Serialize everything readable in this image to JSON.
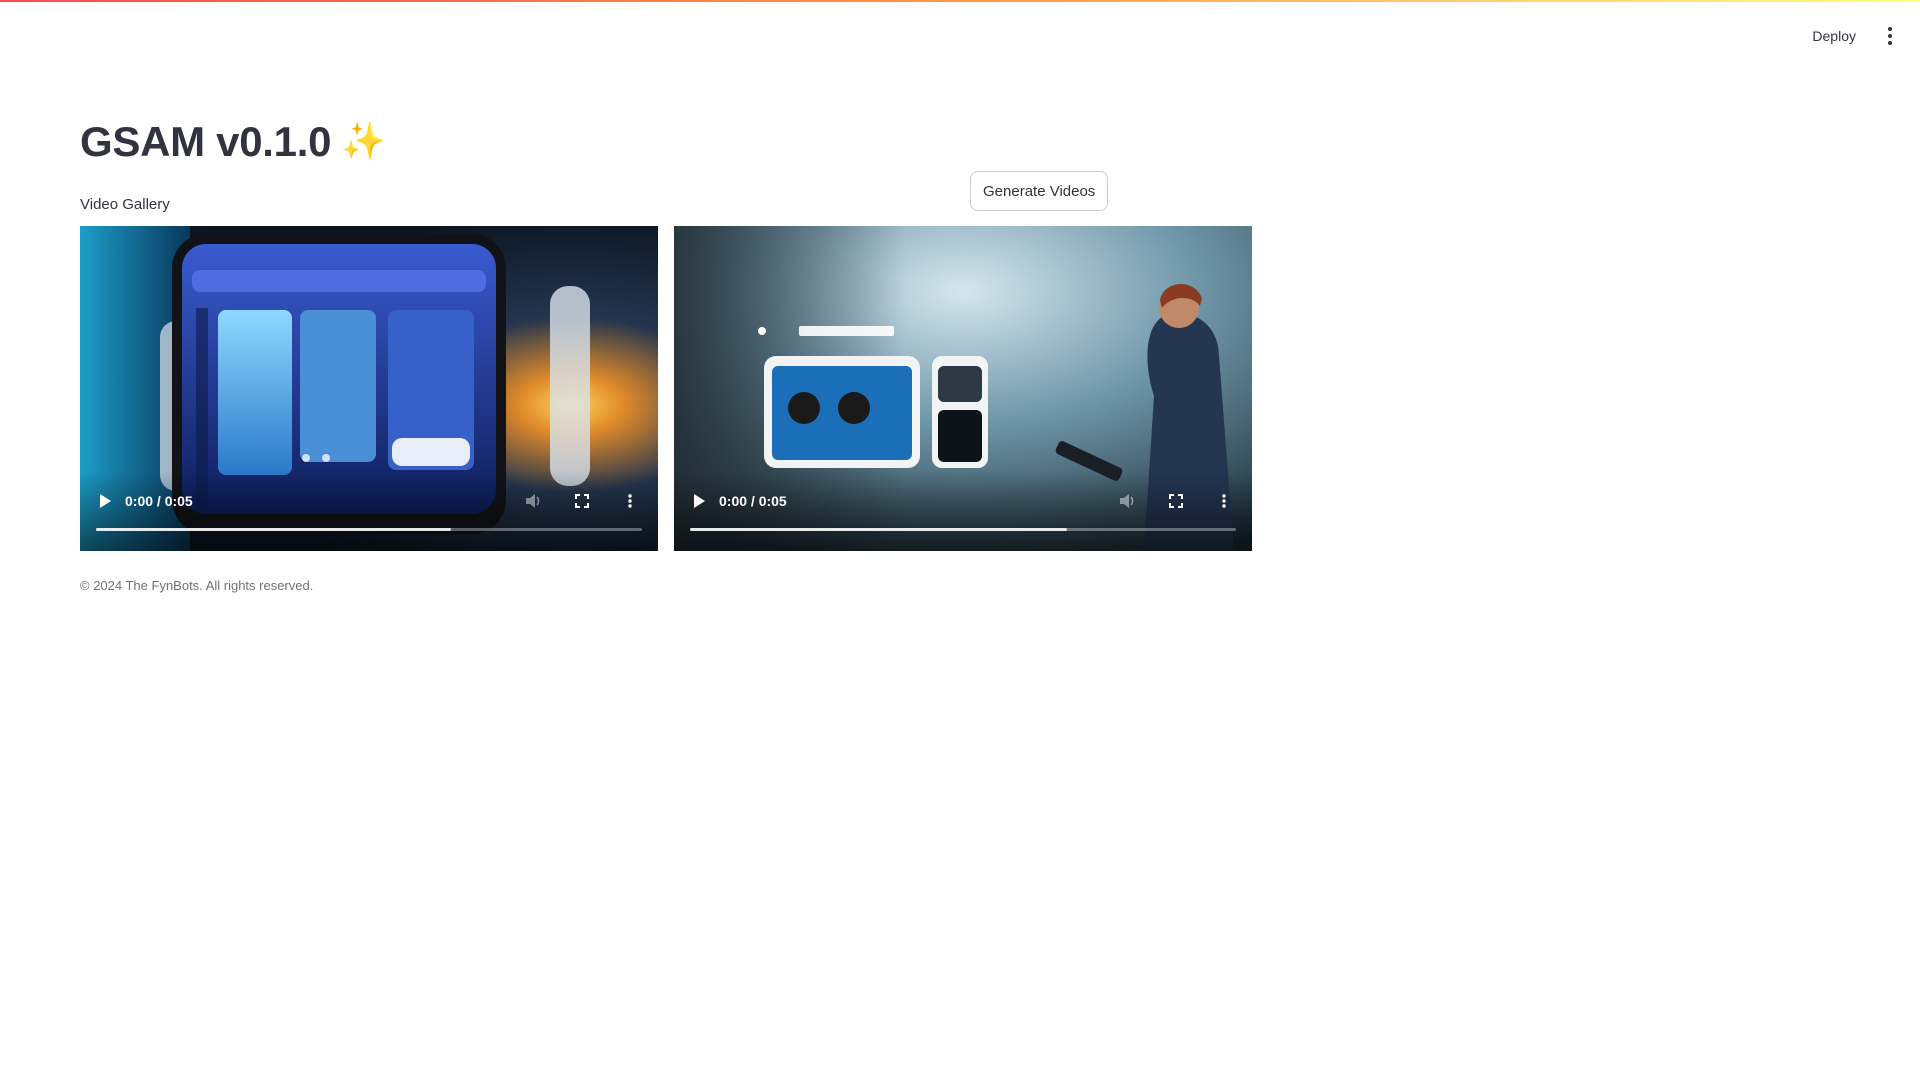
{
  "toolbar": {
    "deploy_label": "Deploy",
    "menu_icon": "kebab-menu-icon"
  },
  "header": {
    "title": "GSAM v0.1.0",
    "title_emoji": "✨"
  },
  "gallery": {
    "label": "Video Gallery",
    "generate_button": "Generate Videos",
    "videos": [
      {
        "time": "0:00 / 0:05",
        "buffered_fraction": 0.65
      },
      {
        "time": "0:00 / 0:05",
        "buffered_fraction": 0.69
      }
    ]
  },
  "footer": {
    "text": "© 2024 The FynBots. All rights reserved."
  },
  "colors": {
    "accent_gradient_start": "#ff4b4b",
    "accent_gradient_end": "#fffd80",
    "text": "#31333f"
  }
}
